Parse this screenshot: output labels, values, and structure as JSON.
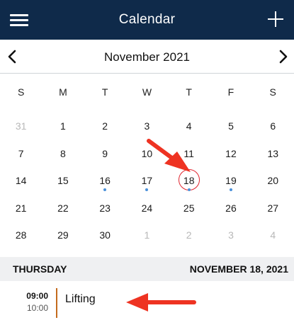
{
  "app": {
    "title": "Calendar",
    "menu_icon": "hamburger-menu-icon",
    "add_icon": "plus-icon"
  },
  "month_nav": {
    "label": "November 2021",
    "prev_icon": "chevron-left-icon",
    "next_icon": "chevron-right-icon"
  },
  "weekdays": [
    "S",
    "M",
    "T",
    "W",
    "T",
    "F",
    "S"
  ],
  "weeks": [
    [
      {
        "d": "31",
        "muted": true
      },
      {
        "d": "1"
      },
      {
        "d": "2"
      },
      {
        "d": "3"
      },
      {
        "d": "4"
      },
      {
        "d": "5"
      },
      {
        "d": "6"
      }
    ],
    [
      {
        "d": "7"
      },
      {
        "d": "8"
      },
      {
        "d": "9"
      },
      {
        "d": "10"
      },
      {
        "d": "11"
      },
      {
        "d": "12"
      },
      {
        "d": "13"
      }
    ],
    [
      {
        "d": "14"
      },
      {
        "d": "15"
      },
      {
        "d": "16",
        "dot": true
      },
      {
        "d": "17",
        "dot": true
      },
      {
        "d": "18",
        "dot": true,
        "today": true
      },
      {
        "d": "19",
        "dot": true
      },
      {
        "d": "20"
      }
    ],
    [
      {
        "d": "21"
      },
      {
        "d": "22"
      },
      {
        "d": "23"
      },
      {
        "d": "24"
      },
      {
        "d": "25"
      },
      {
        "d": "26"
      },
      {
        "d": "27"
      }
    ],
    [
      {
        "d": "28"
      },
      {
        "d": "29"
      },
      {
        "d": "30"
      },
      {
        "d": "1",
        "muted": true
      },
      {
        "d": "2",
        "muted": true
      },
      {
        "d": "3",
        "muted": true
      },
      {
        "d": "4",
        "muted": true
      }
    ]
  ],
  "agenda": {
    "day_of_week": "THURSDAY",
    "date": "NOVEMBER 18, 2021"
  },
  "events": [
    {
      "start": "09:00",
      "end": "10:00",
      "title": "Lifting"
    }
  ],
  "colors": {
    "header_bg": "#0f2a4a",
    "today_ring": "#e0242f",
    "event_dot": "#4a90d9",
    "event_bar": "#c46a1d",
    "annotation_arrow": "#ee3322",
    "agenda_header_bg": "#eff0f2"
  }
}
